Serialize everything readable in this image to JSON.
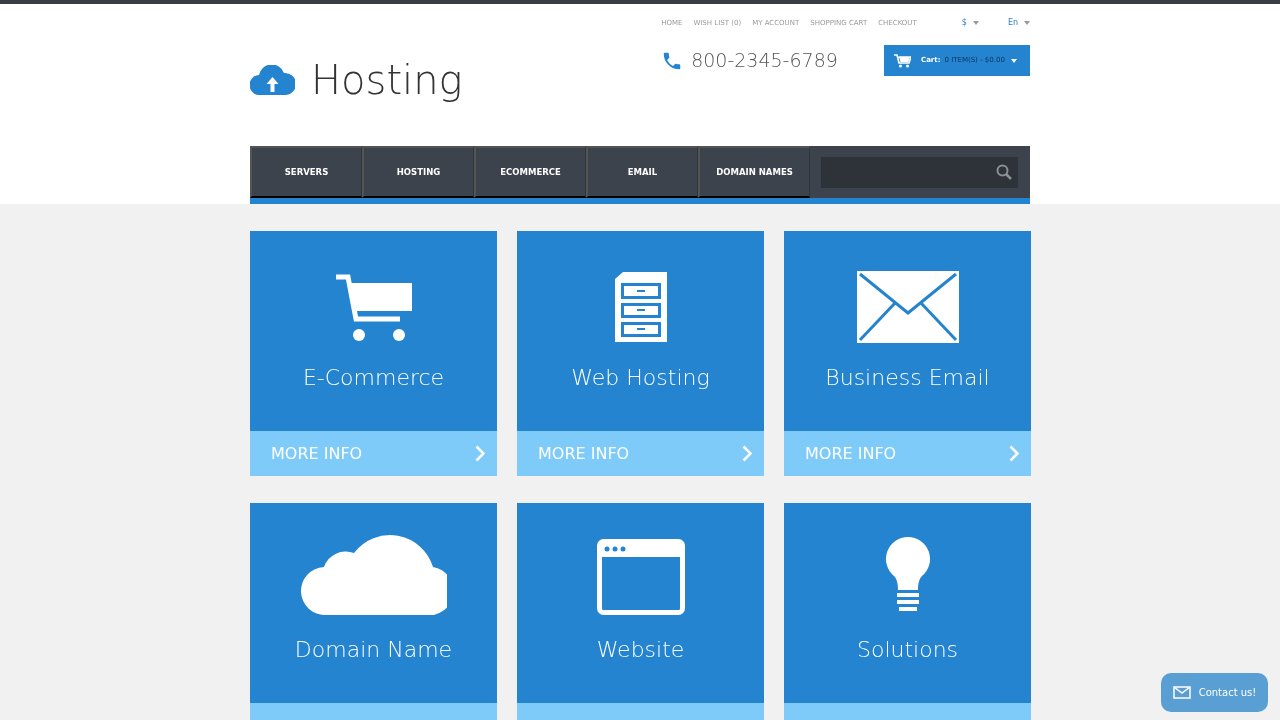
{
  "logo": {
    "text": "Hosting"
  },
  "top_links": [
    "HOME",
    "WISH LIST (0)",
    "MY ACCOUNT",
    "SHOPPING CART",
    "CHECKOUT"
  ],
  "currency": "$",
  "language": "En",
  "phone": "800-2345-6789",
  "cart": {
    "label": "Cart:",
    "summary": "0 ITEM(S) - $0.00"
  },
  "nav": [
    "SERVERS",
    "HOSTING",
    "ECOMMERCE",
    "EMAIL",
    "DOMAIN NAMES"
  ],
  "cards": [
    {
      "title": "E-Commerce",
      "more_info": "MORE INFO"
    },
    {
      "title": "Web Hosting",
      "more_info": "MORE INFO"
    },
    {
      "title": "Business Email",
      "more_info": "MORE INFO"
    },
    {
      "title": "Domain Name"
    },
    {
      "title": "Website"
    },
    {
      "title": "Solutions"
    }
  ],
  "contact_button": "Contact us!"
}
